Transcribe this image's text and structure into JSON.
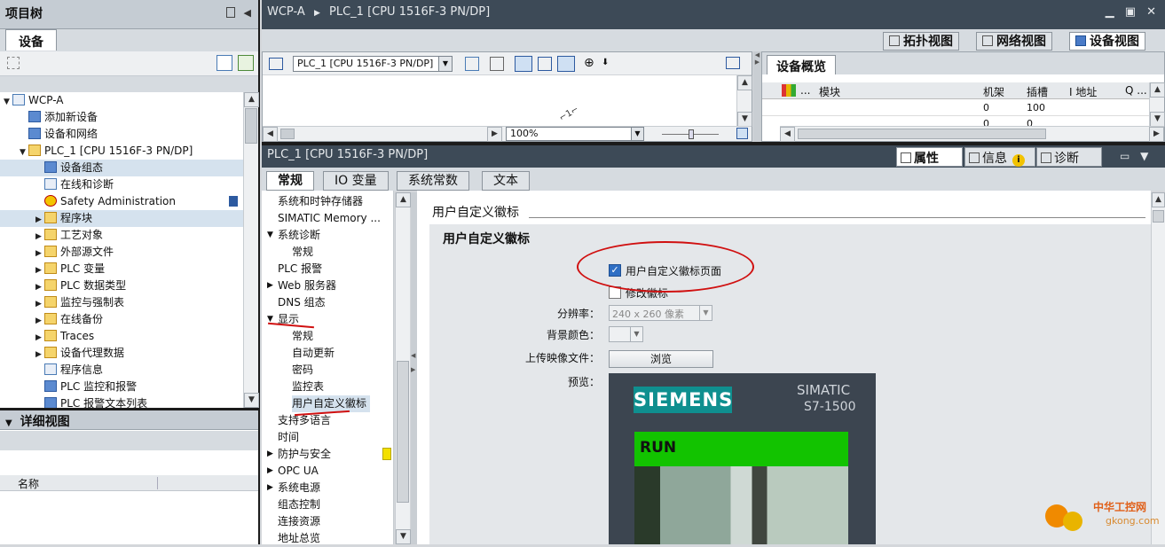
{
  "left_panel": {
    "title": "项目树",
    "tab": "设备",
    "tree": [
      {
        "label": "WCP-A",
        "level": 0
      },
      {
        "label": "添加新设备",
        "level": 1
      },
      {
        "label": "设备和网络",
        "level": 1
      },
      {
        "label": "PLC_1 [CPU 1516F-3 PN/DP]",
        "level": 1
      },
      {
        "label": "设备组态",
        "level": 2
      },
      {
        "label": "在线和诊断",
        "level": 2
      },
      {
        "label": "Safety Administration",
        "level": 2
      },
      {
        "label": "程序块",
        "level": 2
      },
      {
        "label": "工艺对象",
        "level": 2
      },
      {
        "label": "外部源文件",
        "level": 2
      },
      {
        "label": "PLC 变量",
        "level": 2
      },
      {
        "label": "PLC 数据类型",
        "level": 2
      },
      {
        "label": "监控与强制表",
        "level": 2
      },
      {
        "label": "在线备份",
        "level": 2
      },
      {
        "label": "Traces",
        "level": 2
      },
      {
        "label": "设备代理数据",
        "level": 2
      },
      {
        "label": "程序信息",
        "level": 2
      },
      {
        "label": "PLC 监控和报警",
        "level": 2
      },
      {
        "label": "PLC 报警文本列表",
        "level": 2
      }
    ],
    "detail_title": "详细视图",
    "detail_col": "名称"
  },
  "header": {
    "breadcrumb": [
      "WCP-A",
      "PLC_1 [CPU 1516F-3 PN/DP]"
    ],
    "view_tabs": [
      "拓扑视图",
      "网络视图",
      "设备视图"
    ]
  },
  "toolbar": {
    "device_select": "PLC_1 [CPU 1516F-3 PN/DP]",
    "zoom": "100%"
  },
  "overview": {
    "title": "设备概览",
    "columns": [
      "模块",
      "机架",
      "插槽",
      "I 地址",
      "Q ..."
    ],
    "rows": [
      {
        "rack": "0",
        "slot": "100"
      },
      {
        "rack": "0",
        "slot": "0"
      }
    ]
  },
  "properties": {
    "title": "PLC_1 [CPU 1516F-3 PN/DP]",
    "tabs_right": [
      "属性",
      "信息",
      "诊断"
    ],
    "tabs": [
      "常规",
      "IO 变量",
      "系统常数",
      "文本"
    ],
    "nav": [
      {
        "label": "系统和时钟存储器",
        "level": 0
      },
      {
        "label": "SIMATIC Memory ...",
        "level": 0
      },
      {
        "label": "系统诊断",
        "level": 0
      },
      {
        "label": "常规",
        "level": 1
      },
      {
        "label": "PLC 报警",
        "level": 0
      },
      {
        "label": "Web 服务器",
        "level": 0
      },
      {
        "label": "DNS 组态",
        "level": 0
      },
      {
        "label": "显示",
        "level": 0
      },
      {
        "label": "常规",
        "level": 1
      },
      {
        "label": "自动更新",
        "level": 1
      },
      {
        "label": "密码",
        "level": 1
      },
      {
        "label": "监控表",
        "level": 1
      },
      {
        "label": "用户自定义徽标",
        "level": 1
      },
      {
        "label": "支持多语言",
        "level": 0
      },
      {
        "label": "时间",
        "level": 0
      },
      {
        "label": "防护与安全",
        "level": 0
      },
      {
        "label": "OPC UA",
        "level": 0
      },
      {
        "label": "系统电源",
        "level": 0
      },
      {
        "label": "组态控制",
        "level": 0
      },
      {
        "label": "连接资源",
        "level": 0
      },
      {
        "label": "地址总览",
        "level": 0
      }
    ],
    "section_title": "用户自定义徽标",
    "group_title": "用户自定义徽标",
    "checkbox1": "用户自定义徽标页面",
    "checkbox2": "修改徽标",
    "resolution_label": "分辨率：",
    "resolution_value": "240 x 260 像素",
    "bgcolor_label": "背景颜色：",
    "upload_label": "上传映像文件：",
    "browse_button": "浏览",
    "preview_label": "预览：",
    "preview": {
      "brand": "SIEMENS",
      "product_line1": "SIMATIC",
      "product_line2": "S7-1500",
      "status": "RUN"
    }
  },
  "watermark": {
    "cn": "中华工控网",
    "url": "gkong.com"
  }
}
